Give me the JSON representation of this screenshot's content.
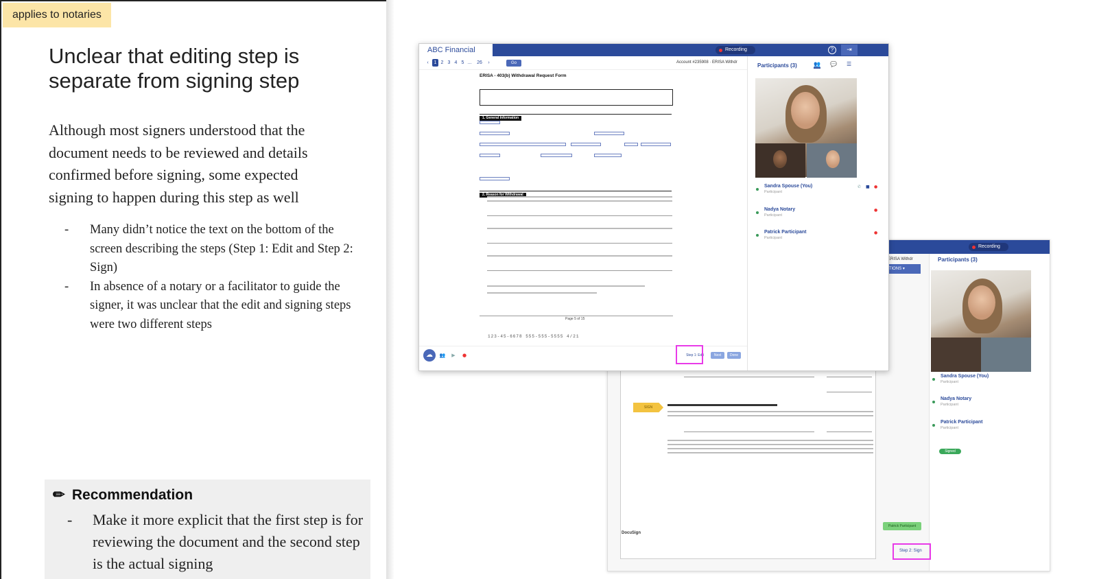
{
  "tag": "applies to notaries",
  "title": "Unclear that editing step is separate from signing step",
  "body": "Although most signers understood that the document needs to be reviewed and details confirmed before signing, some expected signing to happen during this step as well",
  "bullets": [
    "Many didn’t notice the text on the bottom of the screen describing the steps (Step 1: Edit and Step 2: Sign)",
    "In absence of a notary or a facilitator to guide the signer, it was unclear that the edit and signing steps were two different steps"
  ],
  "dash": "-",
  "recommendation": {
    "icon": "pencil-icon",
    "pencil": "✏",
    "heading": "Recommendation",
    "items": [
      "Make it more explicit that the first step is for reviewing the document and the second step is the actual signing"
    ]
  },
  "screenshot1": {
    "brand": "ABC Financial",
    "recording": "Recording",
    "help": "?",
    "pages": [
      "1",
      "2",
      "3",
      "4",
      "5",
      "...",
      "26"
    ],
    "go": "Go",
    "account": "Account #235908 · ERISA Withdr",
    "doc_title": "ERISA - 403(b) Withdrawal Request Form",
    "sections": [
      "1. General Information",
      "2. Reason for Withdrawal"
    ],
    "doc_footer": "Page 5 of 15",
    "handwriting": "123-45-6678        555-555-5555        4/21",
    "participants_title": "Participants (3)",
    "participants": [
      {
        "name": "Sandra Spouse (You)",
        "role": "Participant"
      },
      {
        "name": "Nadya Notary",
        "role": "Participant"
      },
      {
        "name": "Patrick Participant",
        "role": "Participant"
      }
    ],
    "step1": "Step 1: Edit",
    "next": "Next",
    "done": "Done"
  },
  "screenshot2": {
    "recording": "Recording",
    "account": "Account #235908 · ERISA Withdr",
    "other_actions": "OTHER ACTIONS ▾",
    "sign_tag": "SIGN",
    "logo": "DocuSign",
    "participants_title": "Participants (3)",
    "participants": [
      {
        "name": "Sandra Spouse (You)",
        "role": "Participant"
      },
      {
        "name": "Nadya Notary",
        "role": "Participant"
      },
      {
        "name": "Patrick Participant",
        "role": "Participant"
      }
    ],
    "signed": "Signed",
    "finish_btn": "Patrick Participant",
    "step2": "Step 2: Sign"
  },
  "colors": {
    "tag_bg": "#fce5a7",
    "highlight": "#e83ae8",
    "brand_blue": "#2b4a9a",
    "rec_bg": "#efefef"
  }
}
